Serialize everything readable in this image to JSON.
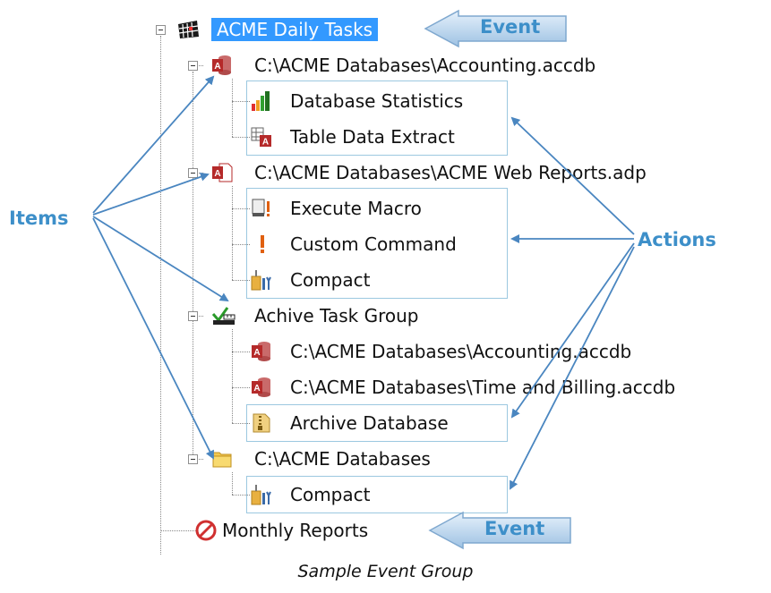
{
  "tree": {
    "root": {
      "label": "ACME Daily Tasks",
      "icon": "calendar-grid-icon"
    },
    "db1": {
      "label": "C:\\ACME Databases\\Accounting.accdb",
      "icon": "access-database-icon",
      "actions": [
        {
          "label": "Database Statistics",
          "icon": "bar-chart-icon"
        },
        {
          "label": "Table Data Extract",
          "icon": "table-extract-icon"
        }
      ]
    },
    "db2": {
      "label": "C:\\ACME Databases\\ACME Web Reports.adp",
      "icon": "access-project-icon",
      "actions": [
        {
          "label": "Execute Macro",
          "icon": "macro-icon"
        },
        {
          "label": "Custom Command",
          "icon": "exclamation-icon"
        },
        {
          "label": "Compact",
          "icon": "compact-tools-icon"
        }
      ]
    },
    "group": {
      "label": "Achive Task Group",
      "icon": "task-group-icon",
      "items": [
        {
          "label": "C:\\ACME Databases\\Accounting.accdb",
          "icon": "access-database-icon"
        },
        {
          "label": "C:\\ACME Databases\\Time and Billing.accdb",
          "icon": "access-database-icon"
        }
      ],
      "actions": [
        {
          "label": "Archive Database",
          "icon": "archive-zip-icon"
        }
      ]
    },
    "folder": {
      "label": "C:\\ACME Databases",
      "icon": "folder-icon",
      "actions": [
        {
          "label": "Compact",
          "icon": "compact-tools-icon"
        }
      ]
    },
    "monthly": {
      "label": "Monthly Reports",
      "icon": "disabled-circle-icon"
    }
  },
  "annotations": {
    "event_top": "Event",
    "event_bottom": "Event",
    "items": "Items",
    "actions": "Actions"
  },
  "colors": {
    "accent": "#3d8fc9",
    "selection": "#3399ff",
    "box_border": "#9cc8e0",
    "access_red": "#b52a2a"
  },
  "caption": "Sample Event Group"
}
